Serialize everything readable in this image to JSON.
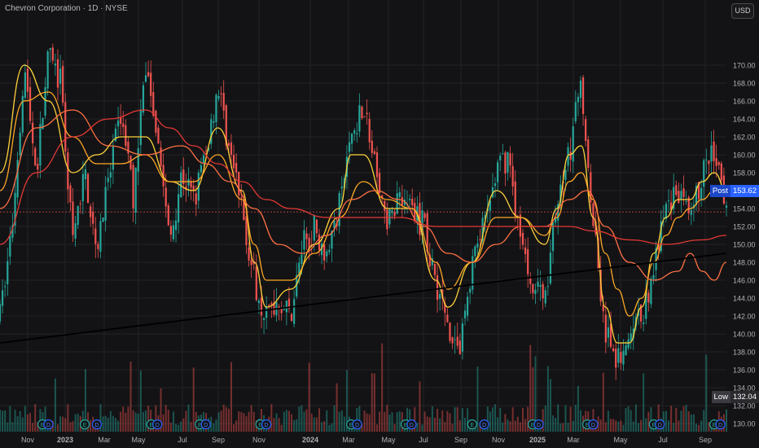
{
  "header": {
    "title": "Chevron Corporation · 1D · NYSE",
    "currency_button": "USD"
  },
  "chart_data": {
    "type": "candlestick",
    "title": "Chevron Corporation · 1D · NYSE",
    "currency": "USD",
    "grid": true,
    "y_ticks": [
      130,
      132,
      134,
      136,
      138,
      140,
      142,
      144,
      146,
      148,
      150,
      152,
      154,
      156,
      158,
      160,
      162,
      164,
      166,
      168,
      170
    ],
    "ylim": [
      129.0,
      173.0
    ],
    "x_labels": [
      "Nov",
      "2023",
      "Mar",
      "May",
      "Jul",
      "Sep",
      "Nov",
      "2024",
      "Mar",
      "May",
      "Jul",
      "Sep",
      "Nov",
      "2025",
      "Mar",
      "May",
      "Jul",
      "Sep"
    ],
    "price_path": [
      [
        0,
        142
      ],
      [
        2,
        152
      ],
      [
        4,
        170
      ],
      [
        6,
        158
      ],
      [
        8,
        171
      ],
      [
        10,
        168
      ],
      [
        12,
        150
      ],
      [
        14,
        158
      ],
      [
        16,
        150
      ],
      [
        18,
        157
      ],
      [
        20,
        165
      ],
      [
        22,
        155
      ],
      [
        24,
        170
      ],
      [
        26,
        163
      ],
      [
        28,
        150
      ],
      [
        30,
        158
      ],
      [
        32,
        155
      ],
      [
        34,
        160
      ],
      [
        36,
        168
      ],
      [
        38,
        160
      ],
      [
        40,
        154
      ],
      [
        42,
        146
      ],
      [
        44,
        142
      ],
      [
        46,
        144
      ],
      [
        48,
        142
      ],
      [
        50,
        150
      ],
      [
        52,
        152
      ],
      [
        54,
        149
      ],
      [
        56,
        154
      ],
      [
        58,
        162
      ],
      [
        60,
        166
      ],
      [
        62,
        158
      ],
      [
        64,
        152
      ],
      [
        66,
        156
      ],
      [
        68,
        154
      ],
      [
        70,
        152
      ],
      [
        72,
        146
      ],
      [
        74,
        141
      ],
      [
        76,
        138
      ],
      [
        78,
        148
      ],
      [
        80,
        152
      ],
      [
        82,
        158
      ],
      [
        84,
        160
      ],
      [
        86,
        150
      ],
      [
        88,
        146
      ],
      [
        90,
        144
      ],
      [
        92,
        155
      ],
      [
        94,
        160
      ],
      [
        96,
        168
      ],
      [
        98,
        153
      ],
      [
        100,
        140
      ],
      [
        102,
        137
      ],
      [
        104,
        139
      ],
      [
        106,
        142
      ],
      [
        108,
        147
      ],
      [
        110,
        154
      ],
      [
        112,
        156
      ],
      [
        114,
        152
      ],
      [
        116,
        158
      ],
      [
        118,
        160
      ],
      [
        120,
        153.6
      ]
    ],
    "trendline": {
      "from": [
        0,
        139.0
      ],
      "to": [
        120,
        149.0
      ]
    },
    "moving_averages": [
      {
        "color": "#ffd33a",
        "points": [
          [
            0,
            158
          ],
          [
            4,
            170
          ],
          [
            8,
            166
          ],
          [
            12,
            158
          ],
          [
            16,
            160
          ],
          [
            20,
            162
          ],
          [
            24,
            162
          ],
          [
            28,
            157
          ],
          [
            32,
            156
          ],
          [
            36,
            163
          ],
          [
            40,
            156
          ],
          [
            42,
            148
          ],
          [
            44,
            143
          ],
          [
            48,
            145
          ],
          [
            52,
            150
          ],
          [
            56,
            154
          ],
          [
            58,
            160
          ],
          [
            60,
            160
          ],
          [
            64,
            154
          ],
          [
            68,
            154
          ],
          [
            72,
            146
          ],
          [
            74,
            143
          ],
          [
            78,
            148
          ],
          [
            82,
            156
          ],
          [
            86,
            153
          ],
          [
            90,
            150
          ],
          [
            92,
            154
          ],
          [
            94,
            160
          ],
          [
            96,
            161
          ],
          [
            98,
            153
          ],
          [
            100,
            143
          ],
          [
            102,
            139
          ],
          [
            104,
            139
          ],
          [
            106,
            143
          ],
          [
            108,
            149
          ],
          [
            110,
            153
          ],
          [
            112,
            155
          ],
          [
            114,
            155
          ],
          [
            116,
            157
          ],
          [
            118,
            158
          ],
          [
            120,
            156
          ]
        ]
      },
      {
        "color": "#ffa726",
        "points": [
          [
            0,
            156
          ],
          [
            4,
            166
          ],
          [
            8,
            167
          ],
          [
            12,
            162
          ],
          [
            16,
            159
          ],
          [
            20,
            159
          ],
          [
            24,
            160
          ],
          [
            28,
            157
          ],
          [
            32,
            157
          ],
          [
            36,
            160
          ],
          [
            40,
            155
          ],
          [
            42,
            150
          ],
          [
            44,
            146
          ],
          [
            48,
            146
          ],
          [
            52,
            149
          ],
          [
            56,
            153
          ],
          [
            60,
            157
          ],
          [
            64,
            155
          ],
          [
            68,
            154
          ],
          [
            72,
            148
          ],
          [
            74,
            145
          ],
          [
            78,
            148
          ],
          [
            82,
            153
          ],
          [
            86,
            153
          ],
          [
            90,
            151
          ],
          [
            92,
            153
          ],
          [
            94,
            157
          ],
          [
            96,
            158
          ],
          [
            98,
            155
          ],
          [
            100,
            149
          ],
          [
            102,
            145
          ],
          [
            104,
            142
          ],
          [
            106,
            144
          ],
          [
            108,
            148
          ],
          [
            110,
            151
          ],
          [
            112,
            153
          ],
          [
            114,
            154
          ],
          [
            116,
            155
          ],
          [
            118,
            156
          ],
          [
            120,
            156
          ]
        ]
      },
      {
        "color": "#ff7043",
        "points": [
          [
            0,
            154
          ],
          [
            6,
            163
          ],
          [
            12,
            165
          ],
          [
            18,
            161
          ],
          [
            24,
            160
          ],
          [
            30,
            161
          ],
          [
            34,
            159
          ],
          [
            38,
            157
          ],
          [
            42,
            154
          ],
          [
            46,
            150
          ],
          [
            50,
            149
          ],
          [
            54,
            151
          ],
          [
            58,
            155
          ],
          [
            62,
            156
          ],
          [
            66,
            155
          ],
          [
            70,
            152
          ],
          [
            74,
            149
          ],
          [
            78,
            148
          ],
          [
            82,
            150
          ],
          [
            86,
            152
          ],
          [
            90,
            152
          ],
          [
            94,
            155
          ],
          [
            97,
            156
          ],
          [
            100,
            152
          ],
          [
            104,
            148
          ],
          [
            108,
            146
          ],
          [
            112,
            147
          ],
          [
            114,
            149
          ],
          [
            116,
            147
          ],
          [
            118,
            146
          ],
          [
            120,
            148
          ]
        ]
      },
      {
        "color": "#e53935",
        "points": [
          [
            0,
            150
          ],
          [
            6,
            158
          ],
          [
            12,
            162
          ],
          [
            18,
            164
          ],
          [
            24,
            165
          ],
          [
            28,
            163
          ],
          [
            32,
            161
          ],
          [
            36,
            159
          ],
          [
            40,
            157
          ],
          [
            44,
            155
          ],
          [
            48,
            154
          ],
          [
            54,
            153
          ],
          [
            60,
            153
          ],
          [
            66,
            153
          ],
          [
            72,
            152
          ],
          [
            78,
            152
          ],
          [
            84,
            152
          ],
          [
            90,
            152
          ],
          [
            94,
            152
          ],
          [
            98,
            151.5
          ],
          [
            104,
            150.5
          ],
          [
            110,
            150
          ],
          [
            116,
            150.5
          ],
          [
            120,
            151
          ]
        ]
      }
    ],
    "last_price": {
      "label": "Post",
      "value": "153.62"
    },
    "low_marker": {
      "label": "Low",
      "value": "132.04"
    },
    "event_marks": [
      {
        "x": 7,
        "letter": "E"
      },
      {
        "x": 8,
        "letter": "D"
      },
      {
        "x": 14,
        "letter": "E"
      },
      {
        "x": 16,
        "letter": "D"
      },
      {
        "x": 25,
        "letter": "E"
      },
      {
        "x": 26,
        "letter": "D"
      },
      {
        "x": 33,
        "letter": "E"
      },
      {
        "x": 34,
        "letter": "D"
      },
      {
        "x": 43,
        "letter": "E"
      },
      {
        "x": 44,
        "letter": "D"
      },
      {
        "x": 58,
        "letter": "E"
      },
      {
        "x": 59,
        "letter": "D"
      },
      {
        "x": 67,
        "letter": "E"
      },
      {
        "x": 68,
        "letter": "D"
      },
      {
        "x": 78,
        "letter": "E"
      },
      {
        "x": 80,
        "letter": "D"
      },
      {
        "x": 88,
        "letter": "E"
      },
      {
        "x": 89,
        "letter": "D"
      },
      {
        "x": 97,
        "letter": "E"
      },
      {
        "x": 98,
        "letter": "D"
      },
      {
        "x": 108,
        "letter": "E"
      },
      {
        "x": 109,
        "letter": "D"
      },
      {
        "x": 118,
        "letter": "E"
      },
      {
        "x": 119,
        "letter": "D"
      }
    ],
    "colors": {
      "up": "#26a69a",
      "down": "#ef5350",
      "background": "#131315",
      "grid": "#232327",
      "trendline": "#000000",
      "price_line": "#ef5350",
      "post_tag": "#2962ff"
    }
  }
}
